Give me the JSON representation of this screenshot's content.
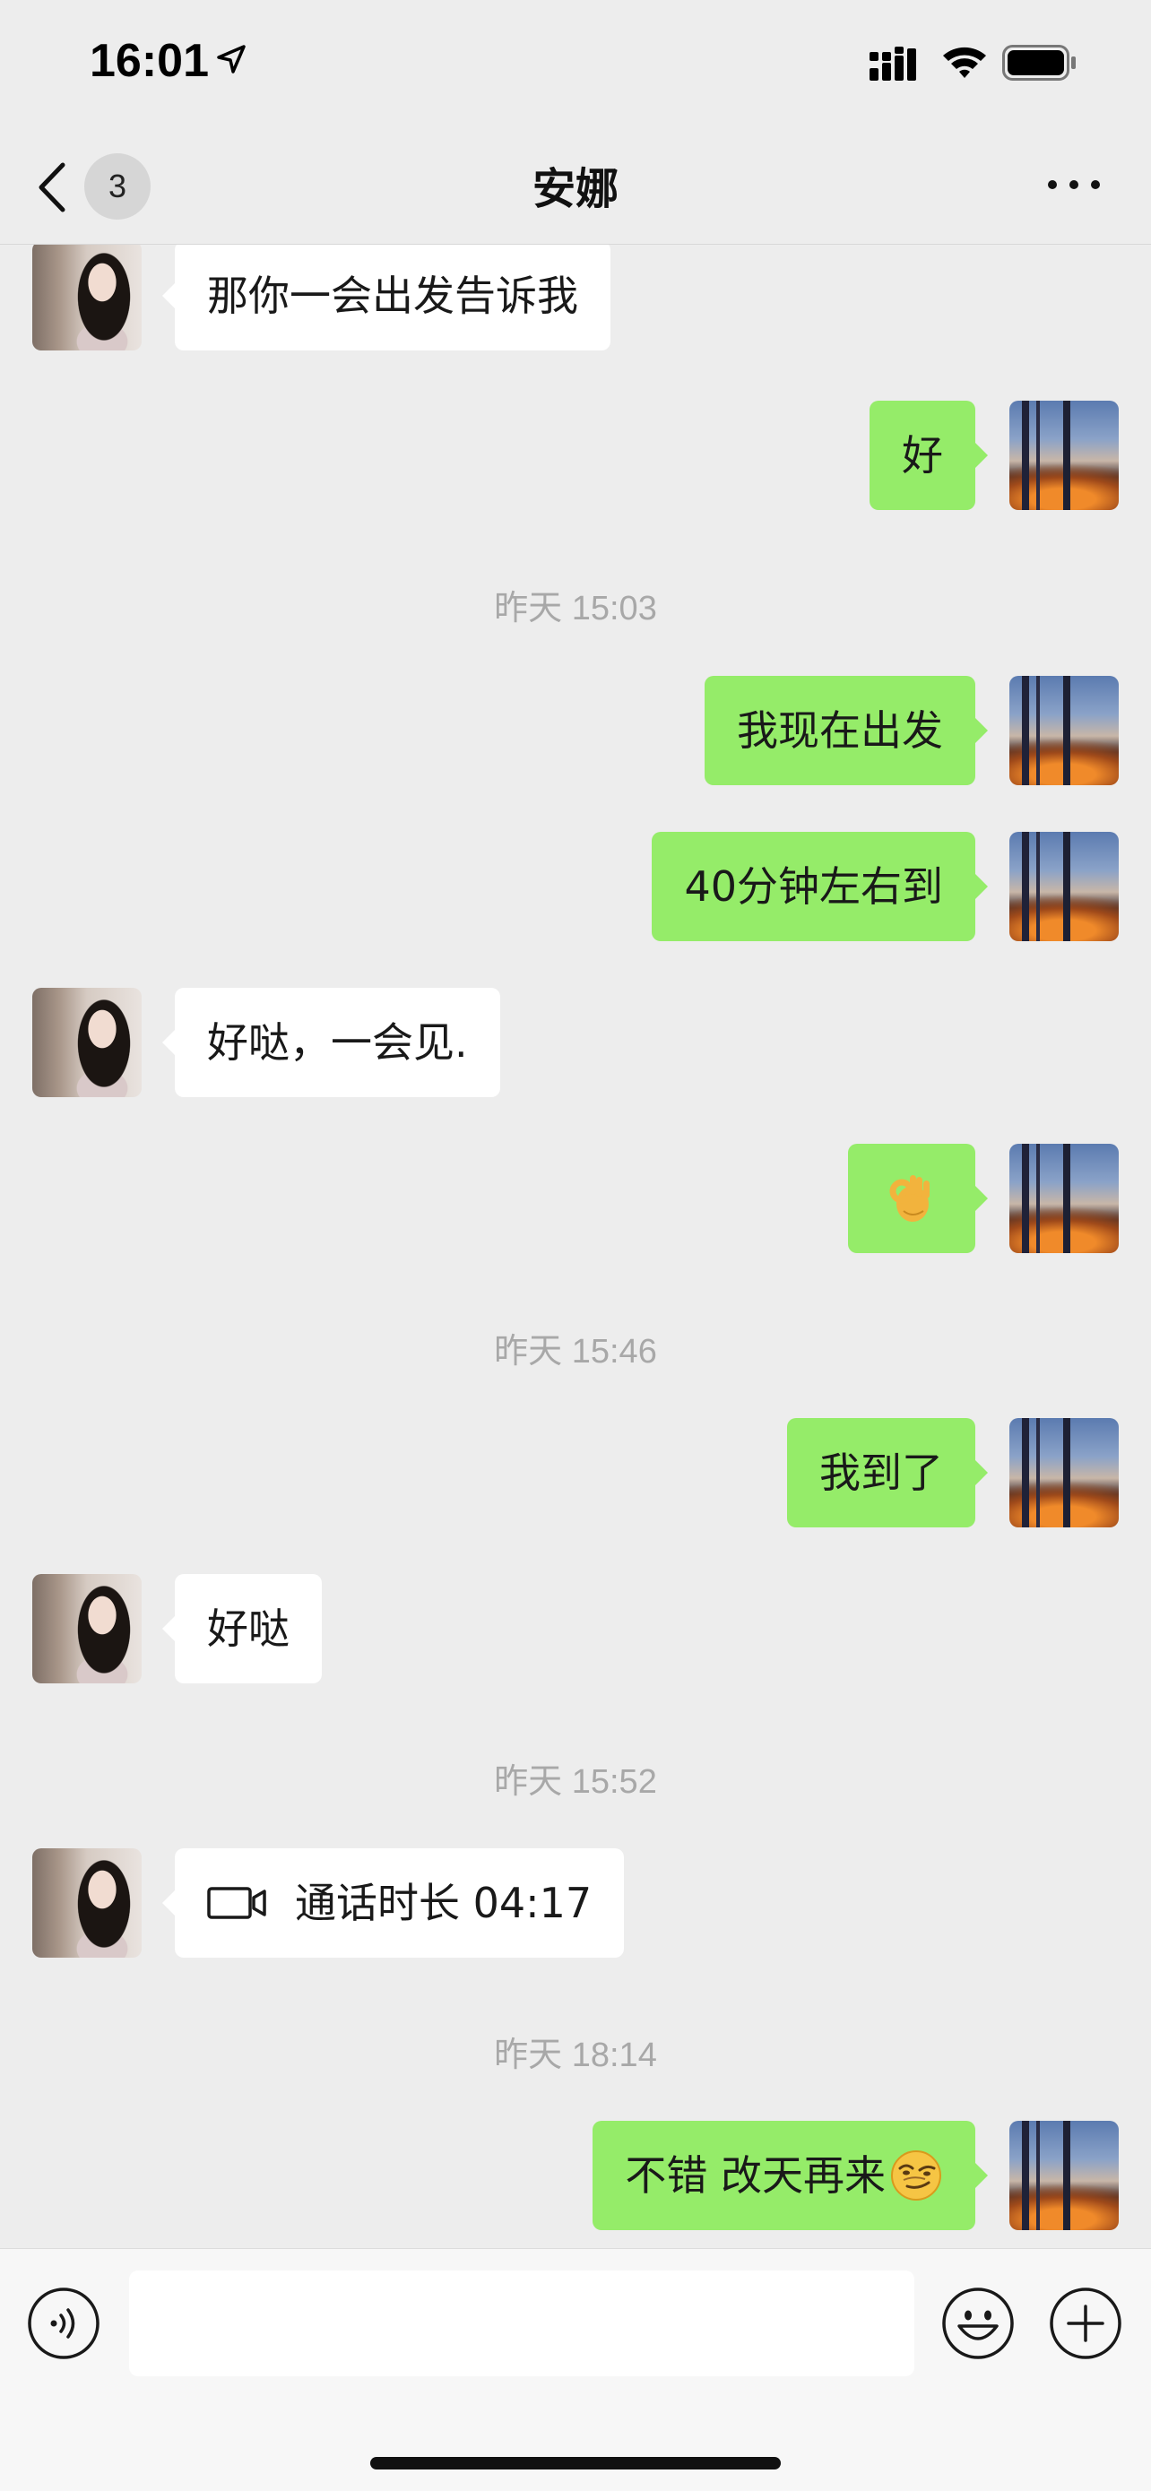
{
  "status_bar": {
    "time": "16:01"
  },
  "nav": {
    "back_label": "back",
    "unread_count": "3",
    "title": "安娜"
  },
  "messages": [
    {
      "side": "in",
      "text": "那你一会出发告诉我"
    },
    {
      "side": "out",
      "text": "好"
    },
    {
      "side": "time",
      "text": "昨天 15:03"
    },
    {
      "side": "out",
      "text": "我现在出发"
    },
    {
      "side": "out",
      "text": "40分钟左右到"
    },
    {
      "side": "in",
      "text": "好哒，一会见."
    },
    {
      "side": "out",
      "text": "👌"
    },
    {
      "side": "time",
      "text": "昨天 15:46"
    },
    {
      "side": "out",
      "text": "我到了"
    },
    {
      "side": "in",
      "text": "好哒"
    },
    {
      "side": "time",
      "text": "昨天 15:52"
    },
    {
      "side": "in",
      "text": "通话时长 04:17",
      "type": "video-call"
    },
    {
      "side": "time",
      "text": "昨天 18:14"
    },
    {
      "side": "out",
      "text": "不错 改天再来",
      "emoji": "smirk-emoji"
    }
  ],
  "input": {
    "value": "",
    "placeholder": ""
  },
  "icons": {
    "voice": "voice-icon",
    "emoji": "emoji-icon",
    "plus": "plus-icon",
    "more": "more-icon",
    "back": "chevron-left-icon"
  },
  "colors": {
    "background": "#ededed",
    "outgoing_bubble": "#95ec69",
    "incoming_bubble": "#ffffff",
    "timestamp_text": "#a8a8a8"
  }
}
